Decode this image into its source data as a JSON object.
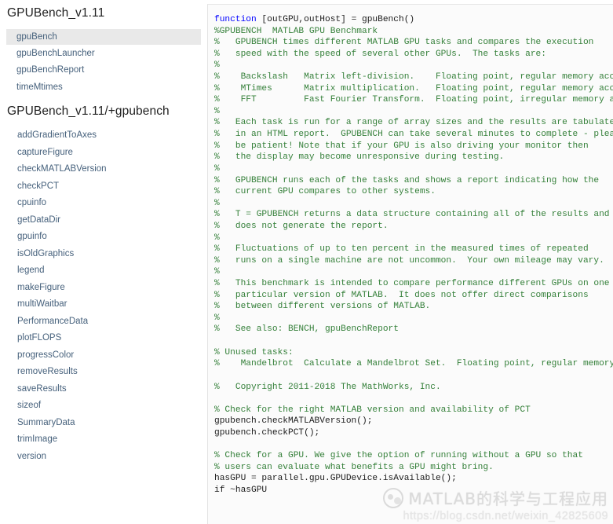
{
  "sidebar": {
    "groups": [
      {
        "title": "GPUBench_v1.11",
        "items": [
          {
            "label": "gpuBench",
            "selected": true
          },
          {
            "label": "gpuBenchLauncher",
            "selected": false
          },
          {
            "label": "gpuBenchReport",
            "selected": false
          },
          {
            "label": "timeMtimes",
            "selected": false
          }
        ]
      },
      {
        "title": "GPUBench_v1.11/+gpubench",
        "items": [
          {
            "label": "addGradientToAxes",
            "selected": false
          },
          {
            "label": "captureFigure",
            "selected": false
          },
          {
            "label": "checkMATLABVersion",
            "selected": false
          },
          {
            "label": "checkPCT",
            "selected": false
          },
          {
            "label": "cpuinfo",
            "selected": false
          },
          {
            "label": "getDataDir",
            "selected": false
          },
          {
            "label": "gpuinfo",
            "selected": false
          },
          {
            "label": "isOldGraphics",
            "selected": false
          },
          {
            "label": "legend",
            "selected": false
          },
          {
            "label": "makeFigure",
            "selected": false
          },
          {
            "label": "multiWaitbar",
            "selected": false
          },
          {
            "label": "PerformanceData",
            "selected": false
          },
          {
            "label": "plotFLOPS",
            "selected": false
          },
          {
            "label": "progressColor",
            "selected": false
          },
          {
            "label": "removeResults",
            "selected": false
          },
          {
            "label": "saveResults",
            "selected": false
          },
          {
            "label": "sizeof",
            "selected": false
          },
          {
            "label": "SummaryData",
            "selected": false
          },
          {
            "label": "trimImage",
            "selected": false
          },
          {
            "label": "version",
            "selected": false
          }
        ]
      }
    ]
  },
  "editor": {
    "language": "matlab",
    "colors": {
      "keyword": "#0000ff",
      "comment": "#35803a",
      "text": "#1c1c1c",
      "background": "#fbfbfb"
    },
    "lines": [
      [
        {
          "t": "function",
          "c": "key"
        },
        {
          "t": " [outGPU,outHost] = gpuBench()",
          "c": "txt"
        }
      ],
      [
        {
          "t": "%GPUBENCH  MATLAB GPU Benchmark",
          "c": "com"
        }
      ],
      [
        {
          "t": "%   GPUBENCH times different MATLAB GPU tasks and compares the execution",
          "c": "com"
        }
      ],
      [
        {
          "t": "%   speed with the speed of several other GPUs.  The tasks are:",
          "c": "com"
        }
      ],
      [
        {
          "t": "%",
          "c": "com"
        }
      ],
      [
        {
          "t": "%    Backslash   Matrix left-division.    Floating point, regular memory access.",
          "c": "com"
        }
      ],
      [
        {
          "t": "%    MTimes      Matrix multiplication.   Floating point, regular memory access.",
          "c": "com"
        }
      ],
      [
        {
          "t": "%    FFT         Fast Fourier Transform.  Floating point, irregular memory access.",
          "c": "com"
        }
      ],
      [
        {
          "t": "%",
          "c": "com"
        }
      ],
      [
        {
          "t": "%   Each task is run for a range of array sizes and the results are tabulated",
          "c": "com"
        }
      ],
      [
        {
          "t": "%   in an HTML report.  GPUBENCH can take several minutes to complete - please",
          "c": "com"
        }
      ],
      [
        {
          "t": "%   be patient! Note that if your GPU is also driving your monitor then",
          "c": "com"
        }
      ],
      [
        {
          "t": "%   the display may become unresponsive during testing.",
          "c": "com"
        }
      ],
      [
        {
          "t": "%",
          "c": "com"
        }
      ],
      [
        {
          "t": "%   GPUBENCH runs each of the tasks and shows a report indicating how the",
          "c": "com"
        }
      ],
      [
        {
          "t": "%   current GPU compares to other systems.",
          "c": "com"
        }
      ],
      [
        {
          "t": "%",
          "c": "com"
        }
      ],
      [
        {
          "t": "%   T = GPUBENCH returns a data structure containing all of the results and",
          "c": "com"
        }
      ],
      [
        {
          "t": "%   does not generate the report.",
          "c": "com"
        }
      ],
      [
        {
          "t": "%",
          "c": "com"
        }
      ],
      [
        {
          "t": "%   Fluctuations of up to ten percent in the measured times of repeated",
          "c": "com"
        }
      ],
      [
        {
          "t": "%   runs on a single machine are not uncommon.  Your own mileage may vary.",
          "c": "com"
        }
      ],
      [
        {
          "t": "%",
          "c": "com"
        }
      ],
      [
        {
          "t": "%   This benchmark is intended to compare performance different GPUs on one",
          "c": "com"
        }
      ],
      [
        {
          "t": "%   particular version of MATLAB.  It does not offer direct comparisons",
          "c": "com"
        }
      ],
      [
        {
          "t": "%   between different versions of MATLAB.",
          "c": "com"
        }
      ],
      [
        {
          "t": "%",
          "c": "com"
        }
      ],
      [
        {
          "t": "%   See also: BENCH, gpuBenchReport",
          "c": "com"
        }
      ],
      [
        {
          "t": "",
          "c": "com"
        }
      ],
      [
        {
          "t": "% Unused tasks:",
          "c": "com"
        }
      ],
      [
        {
          "t": "%    Mandelbrot  Calculate a Mandelbrot Set.  Floating point, regular memory access.",
          "c": "com"
        }
      ],
      [
        {
          "t": "",
          "c": "com"
        }
      ],
      [
        {
          "t": "%   Copyright 2011-2018 The MathWorks, Inc.",
          "c": "com"
        }
      ],
      [
        {
          "t": "",
          "c": "com"
        }
      ],
      [
        {
          "t": "% Check for the right MATLAB version and availability of PCT",
          "c": "com"
        }
      ],
      [
        {
          "t": "gpubench.checkMATLABVersion();",
          "c": "txt"
        }
      ],
      [
        {
          "t": "gpubench.checkPCT();",
          "c": "txt"
        }
      ],
      [
        {
          "t": "",
          "c": "txt"
        }
      ],
      [
        {
          "t": "% Check for a GPU. We give the option of running without a GPU so that",
          "c": "com"
        }
      ],
      [
        {
          "t": "% users can evaluate what benefits a GPU might bring.",
          "c": "com"
        }
      ],
      [
        {
          "t": "hasGPU = parallel.gpu.GPUDevice.isAvailable();",
          "c": "txt"
        }
      ],
      [
        {
          "t": "if ~hasGPU",
          "c": "txt"
        }
      ]
    ]
  },
  "watermark": {
    "title": "MATLAB的科学与工程应用",
    "url": "https://blog.csdn.net/weixin_42825609"
  }
}
